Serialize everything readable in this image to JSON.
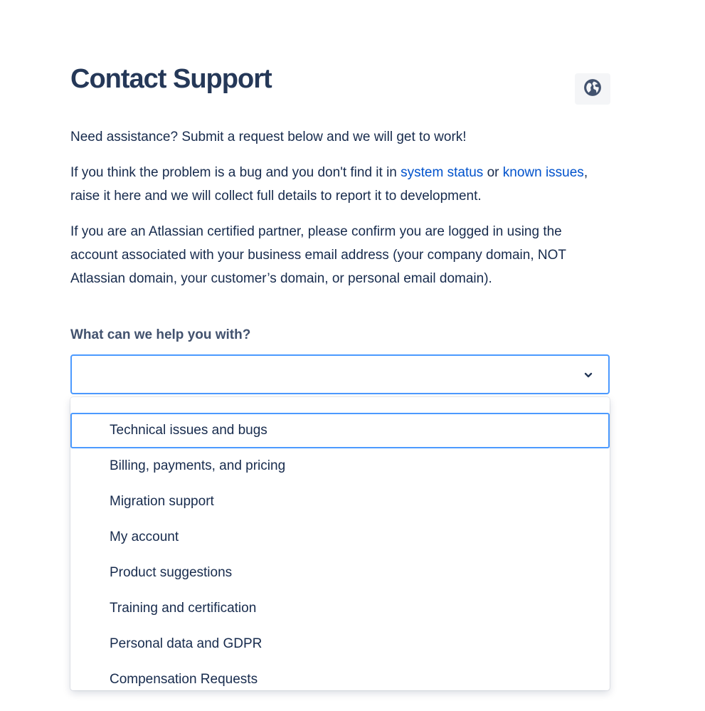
{
  "page": {
    "title": "Contact Support"
  },
  "language_button": {
    "icon": "globe-icon"
  },
  "intro": {
    "p1": "Need assistance? Submit a request below and we will get to work!",
    "p2_before": "If you think the problem is a bug and you don't find it in ",
    "p2_link_status": "system status",
    "p2_between": " or ",
    "p2_link_issues": "known issues",
    "p2_after": ", raise it here and we will collect full details to report it to development.",
    "p3": "If you are an Atlassian certified partner, please confirm you are logged in using the account associated with your business email address (your company domain, NOT Atlassian domain, your customer’s domain, or personal email domain)."
  },
  "form": {
    "label": "What can we help you with?",
    "selected_value": "",
    "chevron_icon": "chevron-down-icon",
    "options": [
      {
        "label": "Technical issues and bugs",
        "focused": true
      },
      {
        "label": "Billing, payments, and pricing",
        "focused": false
      },
      {
        "label": "Migration support",
        "focused": false
      },
      {
        "label": "My account",
        "focused": false
      },
      {
        "label": "Product suggestions",
        "focused": false
      },
      {
        "label": "Training and certification",
        "focused": false
      },
      {
        "label": "Personal data and GDPR",
        "focused": false
      },
      {
        "label": "Compensation Requests",
        "focused": false
      }
    ]
  },
  "colors": {
    "title": "#253858",
    "text": "#172b4d",
    "link": "#0052cc",
    "focus_border": "#4c9aff",
    "label": "#42526e"
  }
}
